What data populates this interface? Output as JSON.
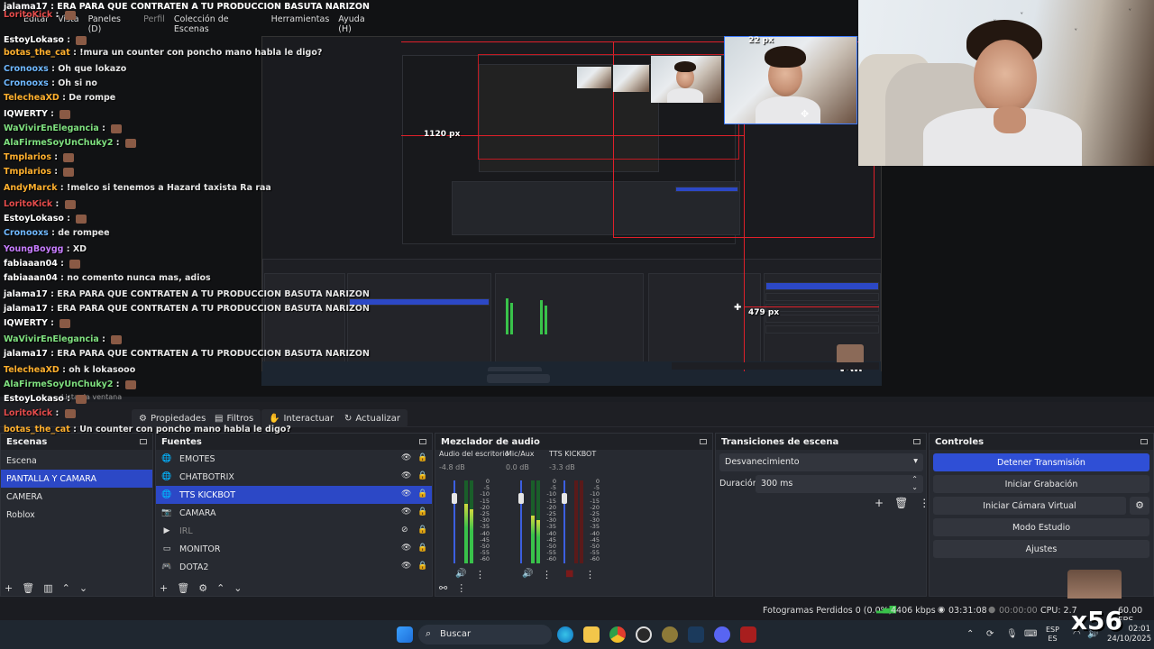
{
  "title": "jalama17 : ERA PARA QUE CONTRATEN A TU PRODUCCION BASUTA NARIZON",
  "menu": [
    "Editar",
    "Vista",
    "Paneles (D)",
    "Perfil",
    "Colección de Escenas",
    "Herramientas",
    "Ayuda (H)"
  ],
  "chat": [
    {
      "user": "LoritoKick",
      "msg": "",
      "color": "#e34b4b"
    },
    {
      "user": "EstoyLokaso",
      "msg": "",
      "color": "#ffffff"
    },
    {
      "user": "botas_the_cat",
      "msg": "!mura un counter con poncho mano habla le digo?",
      "color": "#ffb02e"
    },
    {
      "user": "Cronooxs",
      "msg": "Oh que lokazo",
      "color": "#6fb8ff"
    },
    {
      "user": "Cronooxs",
      "msg": "Oh si no",
      "color": "#6fb8ff"
    },
    {
      "user": "TelecheaXD",
      "msg": "De rompe",
      "color": "#ffb02e"
    },
    {
      "user": "IQWERTY",
      "msg": "",
      "color": "#ffffff"
    },
    {
      "user": "WaVivirEnElegancia",
      "msg": "",
      "color": "#7fe07f"
    },
    {
      "user": "AlaFirmeSoyUnChuky2",
      "msg": "",
      "color": "#7fe07f"
    },
    {
      "user": "Tmplarios",
      "msg": "",
      "color": "#ffb02e"
    },
    {
      "user": "Tmplarios",
      "msg": "",
      "color": "#ffb02e"
    },
    {
      "user": "AndyMarck",
      "msg": "!melco si tenemos a Hazard taxista Ra raa",
      "color": "#ffb02e"
    },
    {
      "user": "LoritoKick",
      "msg": "",
      "color": "#e34b4b"
    },
    {
      "user": "EstoyLokaso",
      "msg": "",
      "color": "#ffffff"
    },
    {
      "user": "Cronooxs",
      "msg": "de rompee",
      "color": "#6fb8ff"
    },
    {
      "user": "YoungBoygg",
      "msg": "XD",
      "color": "#c77dff"
    },
    {
      "user": "fabiaaan04",
      "msg": "",
      "color": "#ffffff"
    },
    {
      "user": "fabiaaan04",
      "msg": "no comento nunca mas, adios",
      "color": "#ffffff"
    },
    {
      "user": "jalama17",
      "msg": "ERA PARA QUE CONTRATEN A TU PRODUCCION BASUTA NARIZON",
      "color": "#ffffff"
    },
    {
      "user": "jalama17",
      "msg": "ERA PARA QUE CONTRATEN A TU PRODUCCION BASUTA NARIZON",
      "color": "#ffffff"
    },
    {
      "user": "IQWERTY",
      "msg": "",
      "color": "#ffffff"
    },
    {
      "user": "WaVivirEnElegancia",
      "msg": "",
      "color": "#7fe07f"
    },
    {
      "user": "jalama17",
      "msg": "ERA PARA QUE CONTRATEN A TU PRODUCCION BASUTA NARIZON",
      "color": "#ffffff"
    },
    {
      "user": "TelecheaXD",
      "msg": "oh k lokasooo",
      "color": "#ffb02e"
    },
    {
      "user": "AlaFirmeSoyUnChuky2",
      "msg": "",
      "color": "#7fe07f"
    },
    {
      "user": "EstoyLokaso",
      "msg": "",
      "color": "#ffffff"
    },
    {
      "user": "LoritoKick",
      "msg": "",
      "color": "#e34b4b"
    },
    {
      "user": "botas_the_cat",
      "msg": "Un counter con poncho mano habla le digo?",
      "color": "#ffb02e"
    }
  ],
  "preview": {
    "px_top": "22 px",
    "px_left": "1120 px",
    "px_right": "479 px",
    "inner_px": "1120 px",
    "overlay_badge": "x56",
    "hidden_label": "Listar la ventana"
  },
  "toolbar": {
    "propiedades": "Propiedades",
    "filtros": "Filtros",
    "interactuar": "Interactuar",
    "actualizar": "Actualizar"
  },
  "scenes": {
    "title": "Escenas",
    "items": [
      "Escena",
      "PANTALLA Y CAMARA",
      "CAMERA",
      "Roblox"
    ],
    "selected": 1
  },
  "sources": {
    "title": "Fuentes",
    "items": [
      {
        "name": "EMOTES",
        "icon": "globe"
      },
      {
        "name": "CHATBOTRIX",
        "icon": "globe"
      },
      {
        "name": "TTS KICKBOT",
        "icon": "globe"
      },
      {
        "name": "CAMARA",
        "icon": "camera"
      },
      {
        "name": "IRL",
        "icon": "play"
      },
      {
        "name": "MONITOR",
        "icon": "monitor"
      },
      {
        "name": "DOTA2",
        "icon": "gamepad"
      }
    ],
    "selected": 2
  },
  "mixer": {
    "title": "Mezclador de audio",
    "channels": [
      {
        "name": "Audio del escritorio",
        "db": "-4.8 dB",
        "level": 0.72
      },
      {
        "name": "Mic/Aux",
        "db": "0.0 dB",
        "level": 0.58
      },
      {
        "name": "TTS KICKBOT",
        "db": "-3.3 dB",
        "level": 0.0
      }
    ],
    "scale": [
      "0",
      "-5",
      "-10",
      "-15",
      "-20",
      "-25",
      "-30",
      "-35",
      "-40",
      "-45",
      "-50",
      "-55",
      "-60"
    ]
  },
  "transitions": {
    "title": "Transiciones de escena",
    "selected": "Desvanecimiento",
    "duration_label": "Duración",
    "duration_value": "300 ms"
  },
  "controls": {
    "title": "Controles",
    "buttons": [
      "Detener Transmisión",
      "Iniciar Grabación",
      "Iniciar Cámara Virtual",
      "Modo Estudio",
      "Ajustes"
    ]
  },
  "status": {
    "dropped": "Fotogramas Perdidos 0 (0.0%)",
    "bitrate": "4406 kbps",
    "stream_time": "03:31:08",
    "rec_time": "00:00:00",
    "cpu": "CPU: 2.7",
    "fps": "60.00 FPS"
  },
  "taskbar": {
    "search": "Buscar",
    "lang": "ESP",
    "lang_sub": "ES",
    "time": "02:01",
    "date": "24/10/2025"
  },
  "colors": {
    "accent": "#2c48c6",
    "panel": "#272a31",
    "red_box": "#e0202a"
  }
}
